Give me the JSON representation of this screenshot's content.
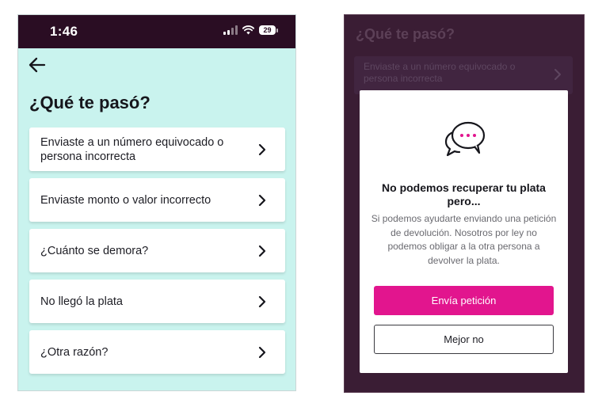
{
  "left_screen": {
    "status_bar": {
      "time": "1:46",
      "battery": "29"
    },
    "title": "¿Qué te pasó?",
    "options": [
      {
        "label": "Enviaste a un número equivocado o persona incorrecta"
      },
      {
        "label": "Enviaste monto o valor incorrecto"
      },
      {
        "label": "¿Cuánto se demora?"
      },
      {
        "label": "No llegó la plata"
      },
      {
        "label": "¿Otra razón?"
      }
    ]
  },
  "right_screen": {
    "background_title": "¿Qué te pasó?",
    "background_option": "Enviaste a un número equivocado o persona incorrecta",
    "modal": {
      "title": "No podemos recuperar tu plata pero...",
      "body": "Si podemos ayudarte enviando una petición de devolución. Nosotros por ley no podemos obligar a la otra persona a devolver la plata.",
      "primary_button": "Envía petición",
      "secondary_button": "Mejor no"
    }
  },
  "colors": {
    "accent": "#e2158e",
    "status_bar": "#2a0d23",
    "left_background": "#c9f3ee",
    "overlay_background": "#3a1d34"
  }
}
